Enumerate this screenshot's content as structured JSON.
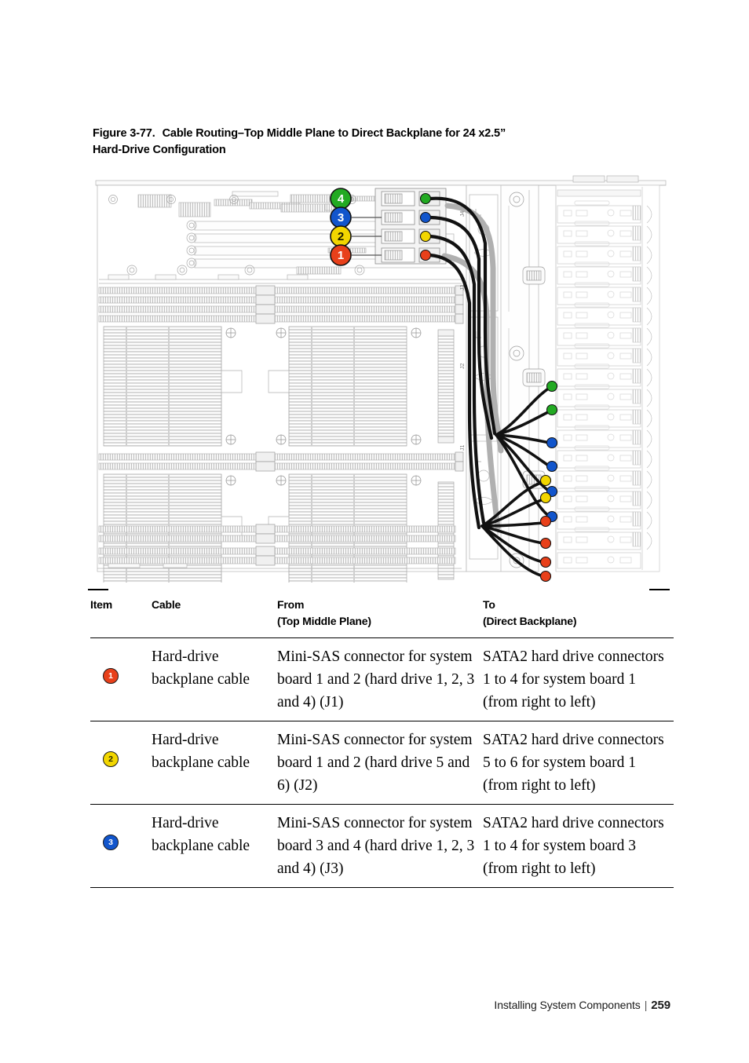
{
  "figure": {
    "number": "Figure 3-77.",
    "title": "Cable Routing–Top Middle Plane to Direct Backplane for 24 x2.5”",
    "title_line2": "Hard-Drive Configuration",
    "callouts": [
      {
        "number": "4",
        "color": "#22aa22",
        "label": "callout-4-green"
      },
      {
        "number": "3",
        "color": "#1155cc",
        "label": "callout-3-blue"
      },
      {
        "number": "2",
        "color": "#f2d600",
        "label": "callout-2-yellow"
      },
      {
        "number": "1",
        "color": "#e8401a",
        "label": "callout-1-red"
      }
    ],
    "connector_labels": [
      "J4",
      "J3",
      "J2",
      "J1"
    ]
  },
  "table": {
    "headers": {
      "item": "Item",
      "cable": "Cable",
      "from": "From",
      "from_sub": "(Top Middle Plane)",
      "to": "To",
      "to_sub": "(Direct Backplane)"
    },
    "rows": [
      {
        "item": "1",
        "item_color": "#e8401a",
        "cable": "Hard-drive backplane cable",
        "from": "Mini-SAS connector for system board 1 and 2 (hard drive 1, 2, 3 and 4) (J1)",
        "to": "SATA2 hard drive connectors 1 to 4 for system board 1 (from right to left)"
      },
      {
        "item": "2",
        "item_color": "#f2d600",
        "cable": "Hard-drive backplane cable",
        "from": "Mini-SAS connector for system board 1 and 2 (hard drive 5 and 6) (J2)",
        "to": "SATA2 hard drive connectors 5 to 6 for system board 1 (from right to left)"
      },
      {
        "item": "3",
        "item_color": "#1155cc",
        "cable": "Hard-drive backplane cable",
        "from": "Mini-SAS connector for system board 3 and 4 (hard drive 1, 2, 3 and 4) (J3)",
        "to": "SATA2 hard drive connectors 1 to 4 for system board 3 (from right to left)"
      }
    ]
  },
  "footer": {
    "section": "Installing System Components",
    "separator": "|",
    "page": "259"
  }
}
